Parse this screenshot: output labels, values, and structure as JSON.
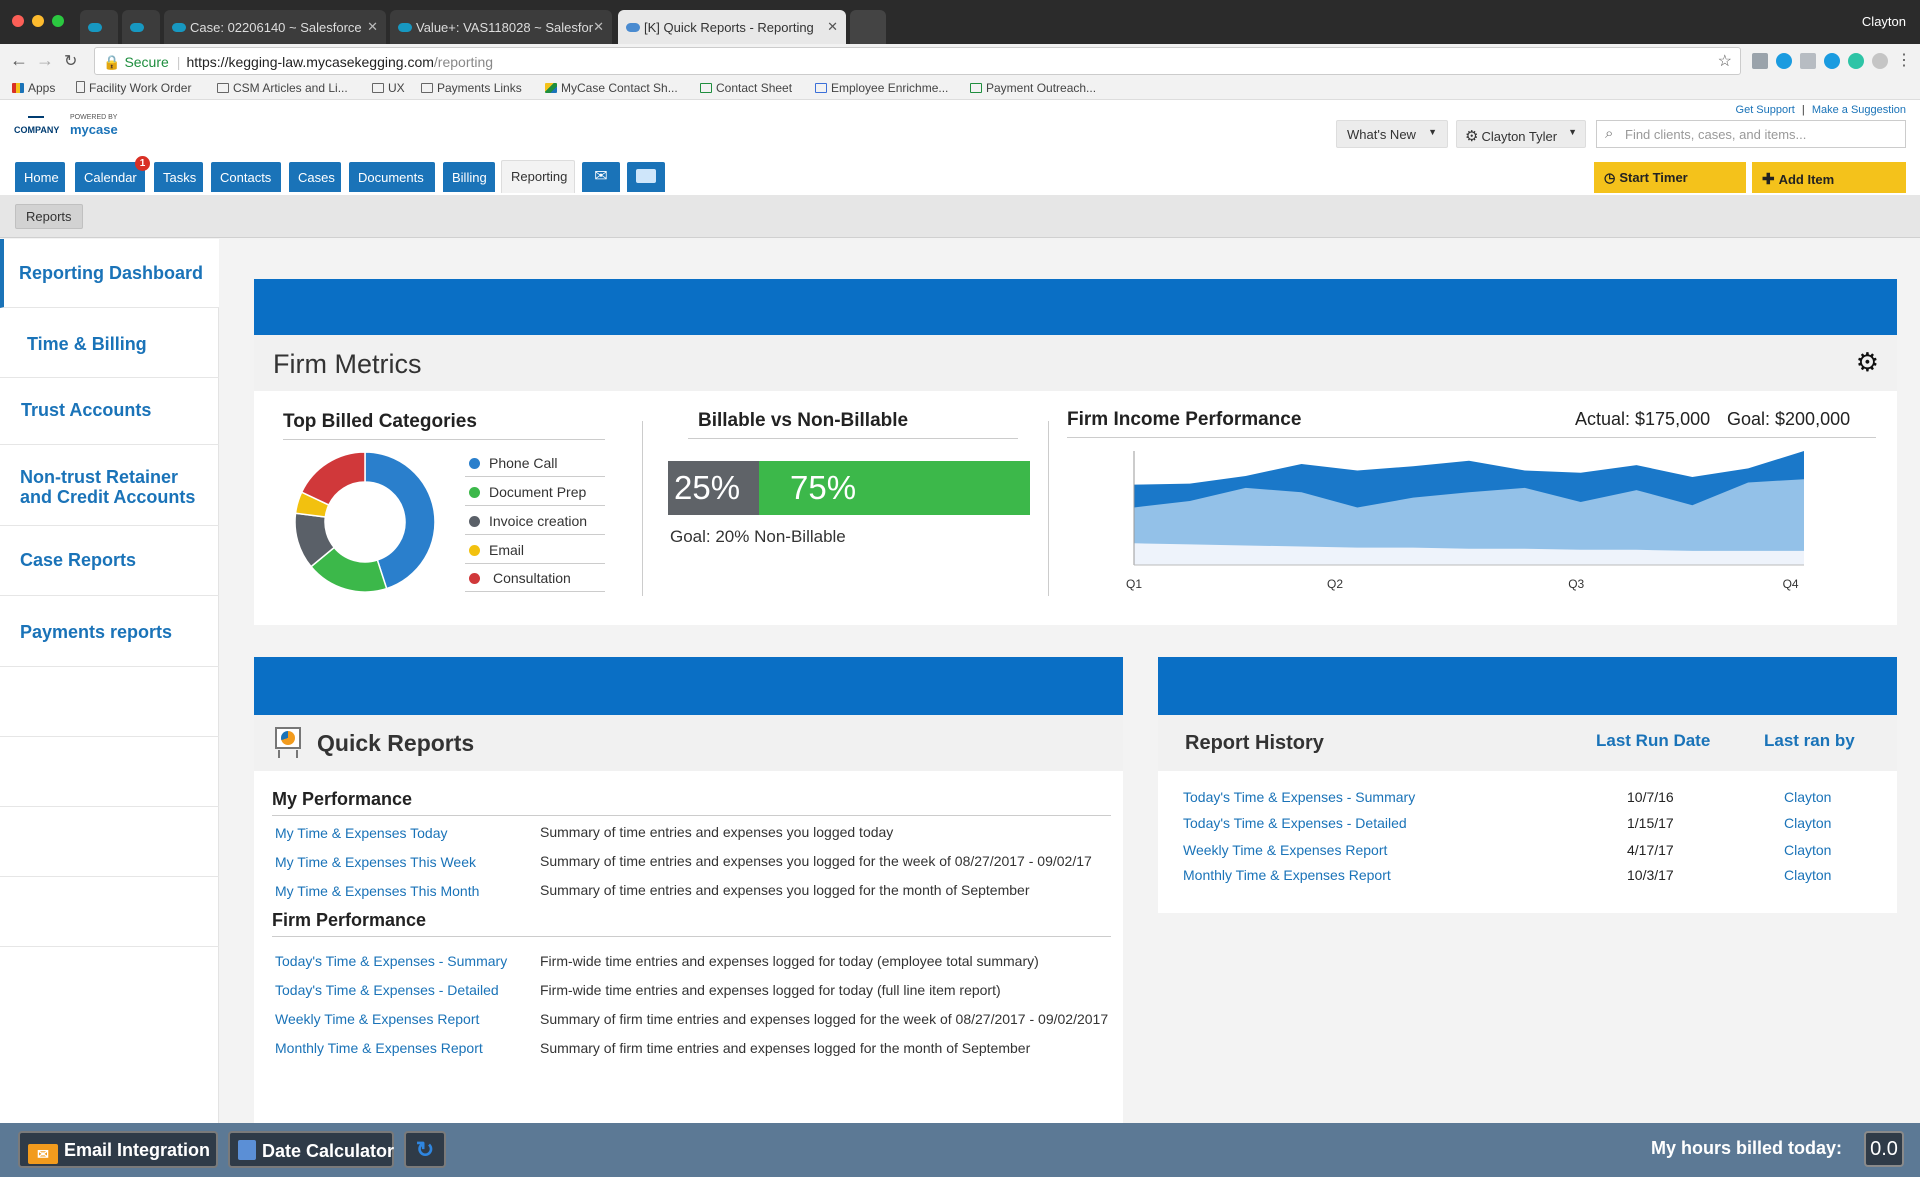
{
  "browser": {
    "tabs": [
      {
        "label": ""
      },
      {
        "label": ""
      },
      {
        "label": "Case: 02206140 ~ Salesforce"
      },
      {
        "label": "Value+: VAS118028 ~ Salesfor"
      },
      {
        "label": "[K] Quick Reports - Reporting"
      }
    ],
    "profile": "Clayton",
    "secure_label": "Secure",
    "url_host": "https://kegging-law.mycasekegging.com",
    "url_path": "/reporting",
    "bookmarks": [
      "Apps",
      "Facility Work Order",
      "CSM Articles and Li...",
      "UX",
      "Payments Links",
      "MyCase Contact Sh...",
      "Contact Sheet",
      "Employee Enrichme...",
      "Payment Outreach..."
    ]
  },
  "header": {
    "logo_company": "COMPANY",
    "logo_powered": "POWERED BY",
    "logo_brand": "mycase",
    "get_support": "Get Support",
    "separator": "|",
    "make_suggestion": "Make a Suggestion",
    "whats_new": "What's New",
    "user": "Clayton Tyler",
    "search_placeholder": "Find clients, cases, and items...",
    "tabs": [
      "Home",
      "Calendar",
      "Tasks",
      "Contacts",
      "Cases",
      "Documents",
      "Billing",
      "Reporting"
    ],
    "calendar_badge": "1",
    "start_timer": "Start Timer",
    "add_item": "Add Item",
    "subnav": "Reports"
  },
  "sidebar": {
    "items": [
      {
        "label": "Reporting Dashboard"
      },
      {
        "label": "Time & Billing"
      },
      {
        "label": "Trust Accounts"
      },
      {
        "label": "Non-trust Retainer and Credit Accounts"
      },
      {
        "label": "Case Reports"
      },
      {
        "label": "Payments reports"
      }
    ]
  },
  "firm_metrics": {
    "title": "Firm Metrics",
    "top_billed": {
      "title": "Top Billed Categories",
      "legend": [
        {
          "name": "Phone Call",
          "color": "#2a7fcc"
        },
        {
          "name": "Document Prep",
          "color": "#3cb84a"
        },
        {
          "name": "Invoice creation",
          "color": "#5a6068"
        },
        {
          "name": "Email",
          "color": "#f2c10f"
        },
        {
          "name": "Consultation",
          "color": "#d0383a"
        }
      ]
    },
    "billable": {
      "title": "Billable vs Non-Billable",
      "non_billable_pct": "25%",
      "billable_pct": "75%",
      "non_billable_fraction": 0.25,
      "goal": "Goal: 20% Non-Billable"
    },
    "income": {
      "title": "Firm Income Performance",
      "actual": "Actual: $175,000",
      "goal": "Goal: $200,000"
    }
  },
  "chart_data": [
    {
      "type": "pie",
      "title": "Top Billed Categories",
      "categories": [
        "Phone Call",
        "Document Prep",
        "Invoice creation",
        "Email",
        "Consultation"
      ],
      "values": [
        45,
        19,
        13,
        5,
        18
      ]
    },
    {
      "type": "area",
      "title": "Firm Income Performance",
      "categories": [
        "Q1",
        "Q2",
        "Q3",
        "Q4"
      ],
      "x": [
        0,
        0.25,
        0.5,
        0.75,
        1.0,
        1.25,
        1.5,
        1.75,
        2.0,
        2.25,
        2.5,
        2.75,
        3.0
      ],
      "series": [
        {
          "values": [
            0.74,
            0.75,
            0.82,
            0.93,
            0.87,
            0.91,
            0.96,
            0.87,
            0.85,
            0.92,
            0.81,
            0.89,
            1.05
          ]
        },
        {
          "values": [
            0.53,
            0.59,
            0.71,
            0.67,
            0.53,
            0.62,
            0.67,
            0.71,
            0.58,
            0.69,
            0.55,
            0.76,
            0.79
          ]
        },
        {
          "values": [
            0.2,
            0.19,
            0.18,
            0.17,
            0.16,
            0.16,
            0.15,
            0.15,
            0.14,
            0.14,
            0.13,
            0.13,
            0.13
          ]
        }
      ]
    }
  ],
  "quick_reports": {
    "title": "Quick Reports",
    "my_performance": {
      "title": "My Performance",
      "rows": [
        {
          "link": "My Time & Expenses Today",
          "desc": "Summary of time entries and expenses you logged today"
        },
        {
          "link": "My Time & Expenses This Week",
          "desc": "Summary of time entries and expenses you logged for the week of 08/27/2017 - 09/02/17"
        },
        {
          "link": "My Time & Expenses This Month",
          "desc": "Summary of time entries and expenses you logged for the month of September"
        }
      ]
    },
    "firm_performance": {
      "title": "Firm Performance",
      "rows": [
        {
          "link": "Today's Time & Expenses - Summary",
          "desc": "Firm-wide time entries and expenses logged for today (employee total summary)"
        },
        {
          "link": "Today's Time & Expenses - Detailed",
          "desc": "Firm-wide time entries and expenses logged for today (full line item report)"
        },
        {
          "link": "Weekly Time & Expenses Report",
          "desc": "Summary of firm time entries and expenses logged for the week of 08/27/2017 - 09/02/2017"
        },
        {
          "link": "Monthly Time & Expenses Report",
          "desc": "Summary of firm time entries and expenses logged for the month of September"
        }
      ]
    }
  },
  "report_history": {
    "title": "Report History",
    "col_date": "Last Run Date",
    "col_user": "Last ran by",
    "rows": [
      {
        "name": "Today's Time & Expenses - Summary",
        "date": "10/7/16",
        "user": "Clayton"
      },
      {
        "name": "Today's Time & Expenses - Detailed",
        "date": "1/15/17",
        "user": "Clayton"
      },
      {
        "name": "Weekly Time & Expenses Report",
        "date": "4/17/17",
        "user": "Clayton"
      },
      {
        "name": "Monthly Time & Expenses Report",
        "date": "10/3/17",
        "user": "Clayton"
      }
    ]
  },
  "footer": {
    "email_integration": "Email Integration",
    "date_calculator": "Date Calculator",
    "hours_label": "My hours billed today:",
    "hours_value": "0.0"
  }
}
